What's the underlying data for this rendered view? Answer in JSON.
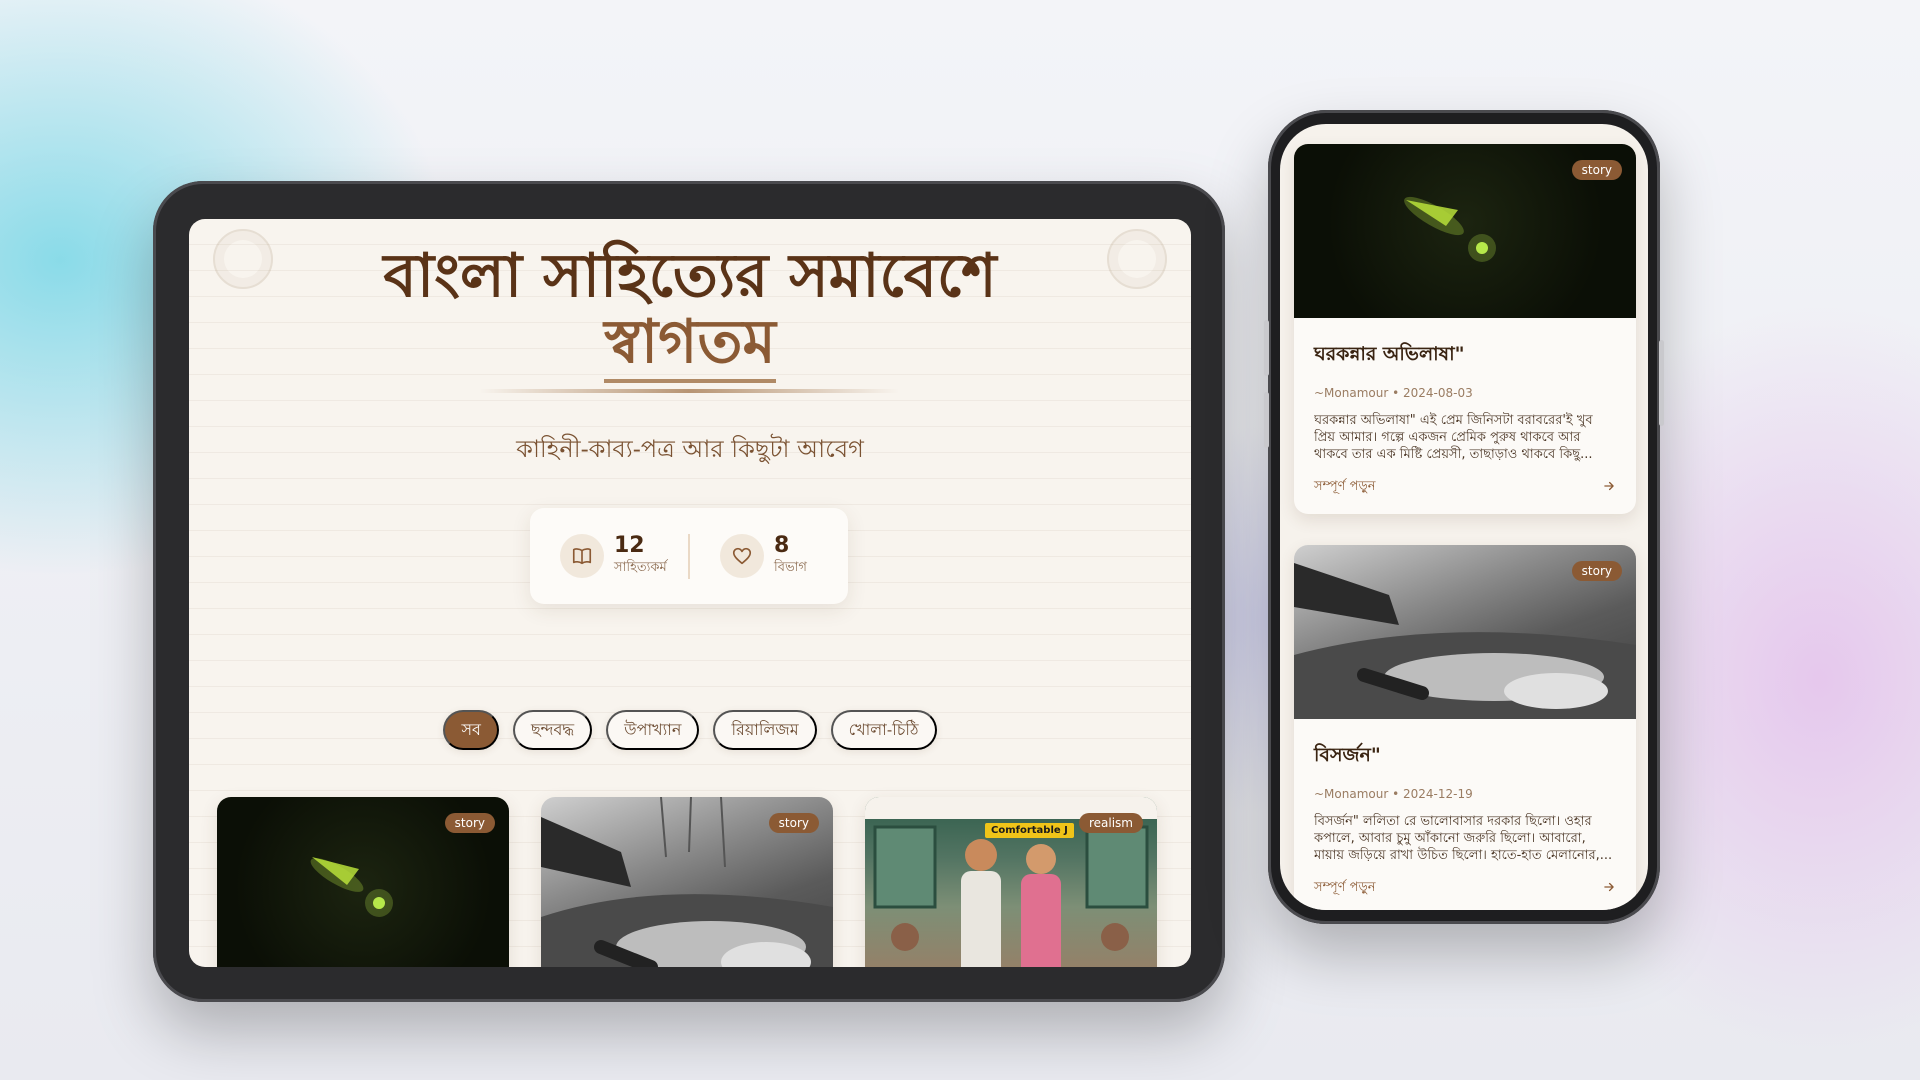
{
  "hero": {
    "title_line1": "বাংলা সাহিত্যের সমাবেশে",
    "title_line2": "স্বাগতম",
    "subtitle": "কাহিনী-কাব্য-পত্র আর কিছুটা আবেগ"
  },
  "stats": [
    {
      "icon": "book-icon",
      "value": "12",
      "label": "সাহিত্যকর্ম"
    },
    {
      "icon": "heart-icon",
      "value": "8",
      "label": "বিভাগ"
    }
  ],
  "filters": [
    {
      "label": "সব",
      "active": true
    },
    {
      "label": "ছন্দবদ্ধ",
      "active": false
    },
    {
      "label": "উপাখ্যান",
      "active": false
    },
    {
      "label": "রিয়ালিজম",
      "active": false
    },
    {
      "label": "খোলা-চিঠি",
      "active": false
    }
  ],
  "tablet_cards": [
    {
      "badge": "story",
      "image": "firefly-in-dark"
    },
    {
      "badge": "story",
      "image": "man-lying-in-grass-bw"
    },
    {
      "badge": "realism",
      "image": "couple-in-train",
      "sign": "Comfortable J"
    }
  ],
  "phone_cards": [
    {
      "badge": "story",
      "image": "firefly-in-dark",
      "title": "ঘরকন্নার অভিলাষা\"",
      "meta": "~Monamour • 2024-08-03",
      "excerpt": "ঘরকন্নার অভিলাষা\" এই প্রেম জিনিসটা বরাবরের'ই খুব প্রিয় আমার। গল্পে একজন প্রেমিক পুরুষ থাকবে আর থাকবে তার এক মিষ্টি প্রেয়সী, তাছাড়াও থাকবে কিছু...",
      "read_more": "সম্পূর্ণ পড়ুন"
    },
    {
      "badge": "story",
      "image": "man-lying-in-grass-bw",
      "title": "বিসর্জন\"",
      "meta": "~Monamour • 2024-12-19",
      "excerpt": "বিসর্জন\" ললিতা রে ভালোবাসার দরকার ছিলো। ওহার কপালে, আবার চুমু আঁকানো জরুরি ছিলো। আবারো, মায়ায় জড়িয়ে রাখা উচিত ছিলো। হাতে-হাত মেলানোর,...",
      "read_more": "সম্পূর্ণ পড়ুন"
    }
  ],
  "colors": {
    "accent": "#8b5a34",
    "title": "#5a3317",
    "page_bg": "#f8f4ee"
  }
}
